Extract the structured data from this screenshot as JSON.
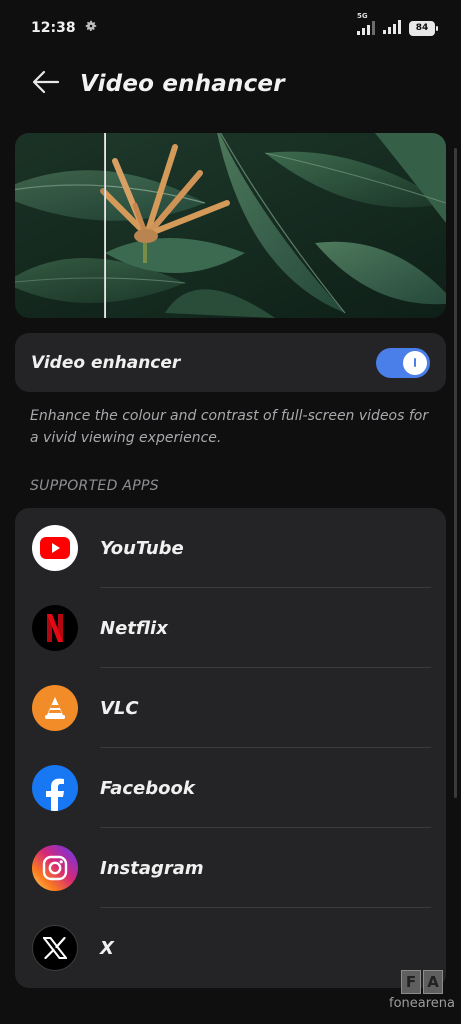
{
  "status_bar": {
    "time": "12:38",
    "network": "5G",
    "battery": "84"
  },
  "header": {
    "title": "Video enhancer",
    "back_icon": "arrow-left-icon"
  },
  "toggle": {
    "label": "Video enhancer",
    "state": "on",
    "accent_color": "#4a7ee8"
  },
  "description": "Enhance the colour and contrast of full-screen videos for a vivid viewing experience.",
  "section_header": "SUPPORTED APPS",
  "apps": [
    {
      "name": "YouTube",
      "icon": "youtube-icon"
    },
    {
      "name": "Netflix",
      "icon": "netflix-icon"
    },
    {
      "name": "VLC",
      "icon": "vlc-icon"
    },
    {
      "name": "Facebook",
      "icon": "facebook-icon"
    },
    {
      "name": "Instagram",
      "icon": "instagram-icon"
    },
    {
      "name": "X",
      "icon": "x-icon"
    }
  ],
  "watermark": {
    "letters": [
      "F",
      "A"
    ],
    "text": "fonearena"
  }
}
